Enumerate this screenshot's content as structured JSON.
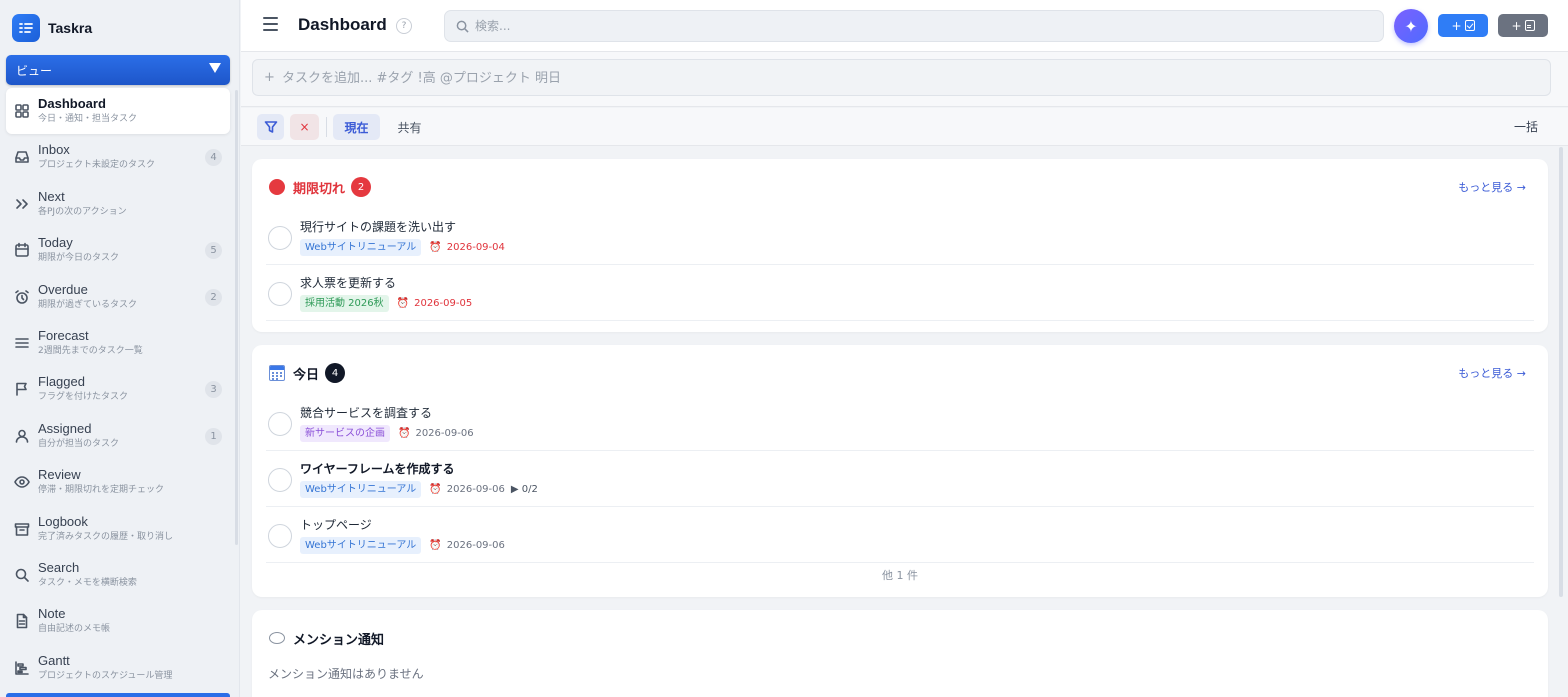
{
  "app": {
    "name": "Taskra",
    "brand_color": "#2f7df6"
  },
  "sidebar": {
    "view_select": "ビュー",
    "items": [
      {
        "label": "Dashboard",
        "sub": "今日・通知・担当タスク",
        "icon": "grid-icon",
        "count": ""
      },
      {
        "label": "Inbox",
        "sub": "プロジェクト未設定のタスク",
        "icon": "inbox-icon",
        "count": "4"
      },
      {
        "label": "Next",
        "sub": "各PJの次のアクション",
        "icon": "chevrons-right-icon",
        "count": ""
      },
      {
        "label": "Today",
        "sub": "期限が今日のタスク",
        "icon": "calendar-icon",
        "count": "5"
      },
      {
        "label": "Overdue",
        "sub": "期限が過ぎているタスク",
        "icon": "alarm-icon",
        "count": "2"
      },
      {
        "label": "Forecast",
        "sub": "2週間先までのタスク一覧",
        "icon": "list-icon",
        "count": ""
      },
      {
        "label": "Flagged",
        "sub": "フラグを付けたタスク",
        "icon": "flag-icon",
        "count": "3"
      },
      {
        "label": "Assigned",
        "sub": "自分が担当のタスク",
        "icon": "user-icon",
        "count": "1"
      },
      {
        "label": "Review",
        "sub": "停滞・期限切れを定期チェック",
        "icon": "eye-icon",
        "count": ""
      },
      {
        "label": "Logbook",
        "sub": "完了済みタスクの履歴・取り消し",
        "icon": "archive-icon",
        "count": ""
      },
      {
        "label": "Search",
        "sub": "タスク・メモを横断検索",
        "icon": "search-icon",
        "count": ""
      },
      {
        "label": "Note",
        "sub": "自由記述のメモ帳",
        "icon": "note-icon",
        "count": ""
      },
      {
        "label": "Gantt",
        "sub": "プロジェクトのスケジュール管理",
        "icon": "gantt-icon",
        "count": ""
      }
    ]
  },
  "header": {
    "title": "Dashboard",
    "help": "?",
    "search_placeholder": "検索...",
    "ai_label": "✦",
    "add_task_label": "+",
    "add_note_label": "+"
  },
  "quickadd": {
    "plus": "+",
    "placeholder": "タスクを追加... #タグ !高 @プロジェクト 明日"
  },
  "filterbar": {
    "clear": "×",
    "now": "現在",
    "shared": "共有",
    "bulk": "一括"
  },
  "sections": {
    "overdue": {
      "title": "期限切れ",
      "count": "2",
      "more": "もっと見る →",
      "tasks": [
        {
          "title": "現行サイトの課題を洗い出す",
          "tag": "Webサイトリニューアル",
          "date": "2026-09-04"
        },
        {
          "title": "求人票を更新する",
          "tag": "採用活動 2026秋",
          "date": "2026-09-05"
        }
      ]
    },
    "today": {
      "title": "今日",
      "count": "4",
      "more": "もっと見る →",
      "tasks": [
        {
          "title": "競合サービスを調査する",
          "tag": "新サービスの企画",
          "date": "2026-09-06",
          "progress": ""
        },
        {
          "title": "ワイヤーフレームを作成する",
          "tag": "Webサイトリニューアル",
          "date": "2026-09-06",
          "progress": "▶ 0/2"
        },
        {
          "title": "トップページ",
          "tag": "Webサイトリニューアル",
          "date": "2026-09-06",
          "progress": ""
        }
      ],
      "more_count": "他 1 件"
    },
    "mention": {
      "title": "メンション通知",
      "empty": "メンション通知はありません"
    }
  },
  "colors": {
    "danger": "#e5393f",
    "accent": "#3b5bd6",
    "tag_blue": "#3474d4",
    "tag_green": "#2e9a57",
    "tag_purple": "#8a4fd8"
  }
}
